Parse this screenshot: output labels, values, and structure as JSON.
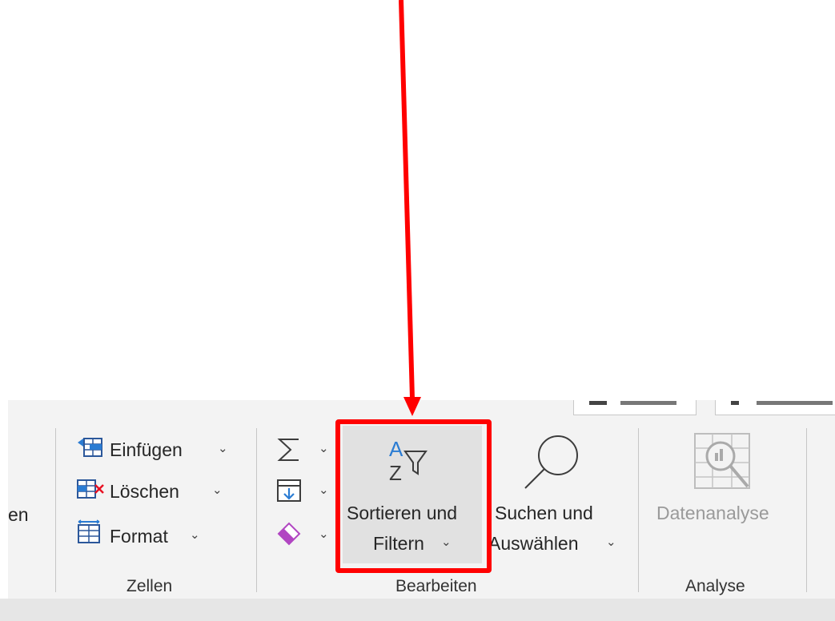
{
  "zellen": {
    "left_clipped_label": "en",
    "einfuegen": "Einfügen",
    "loeschen": "Löschen",
    "format": "Format",
    "group_label": "Zellen"
  },
  "bearbeiten": {
    "sort_filter_line1": "Sortieren und",
    "sort_filter_line2": "Filtern",
    "find_select_line1": "Suchen und",
    "find_select_line2": "Auswählen",
    "group_label": "Bearbeiten"
  },
  "analyse": {
    "datenanalyse": "Datenanalyse",
    "group_label": "Analyse"
  },
  "annotation": {
    "color": "#ff0000",
    "target": "Sortieren und Filtern"
  },
  "chevron": "⌄"
}
